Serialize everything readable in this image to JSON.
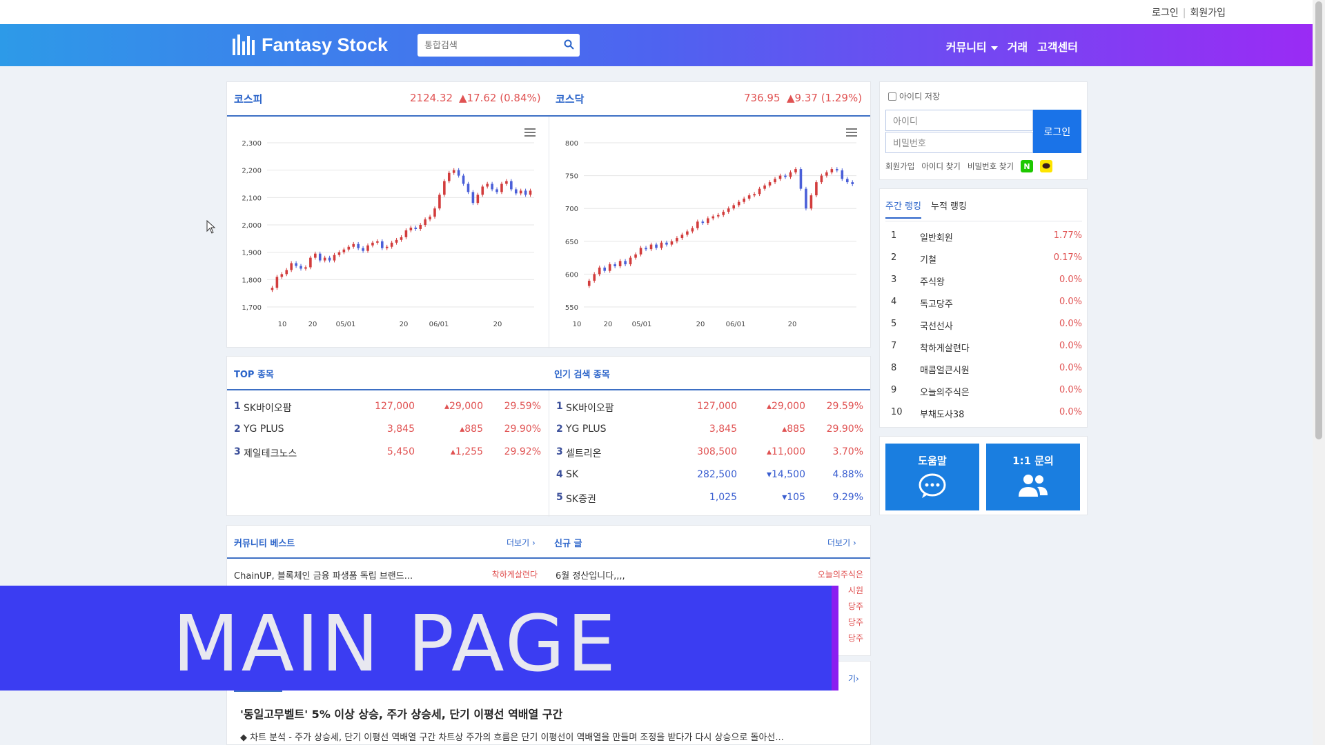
{
  "header": {
    "login": "로그인",
    "signup": "회원가입",
    "logo": "Fantasy Stock",
    "search_placeholder": "통합검색",
    "menu": [
      "커뮤니티",
      "거래",
      "고객센터"
    ]
  },
  "indices": {
    "kospi": {
      "name": "코스피",
      "value": "2124.32",
      "change": "▲17.62 (0.84%)"
    },
    "kosdaq": {
      "name": "코스닥",
      "value": "736.95",
      "change": "▲9.37 (1.29%)"
    }
  },
  "chart_data": [
    {
      "type": "candlestick",
      "name": "코스피",
      "y_ticks": [
        "2,300",
        "2,200",
        "2,100",
        "2,000",
        "1,900",
        "1,800",
        "1,700"
      ],
      "x_ticks": [
        "10",
        "20",
        "05/01",
        "20",
        "06/01",
        "20"
      ],
      "ylim": [
        1700,
        2300
      ],
      "closes": [
        1770,
        1810,
        1820,
        1835,
        1860,
        1850,
        1840,
        1845,
        1880,
        1895,
        1870,
        1880,
        1870,
        1890,
        1900,
        1910,
        1920,
        1930,
        1915,
        1905,
        1925,
        1935,
        1940,
        1915,
        1920,
        1935,
        1945,
        1955,
        1980,
        1990,
        1985,
        2000,
        2020,
        2030,
        2060,
        2110,
        2160,
        2190,
        2200,
        2180,
        2150,
        2120,
        2080,
        2110,
        2140,
        2150,
        2130,
        2120,
        2150,
        2160,
        2130,
        2115,
        2125,
        2110,
        2125
      ]
    },
    {
      "type": "candlestick",
      "name": "코스닥",
      "y_ticks": [
        "800",
        "750",
        "700",
        "650",
        "600",
        "550"
      ],
      "x_ticks": [
        "10",
        "20",
        "05/01",
        "20",
        "06/01",
        "20"
      ],
      "ylim": [
        550,
        800
      ],
      "closes": [
        590,
        600,
        610,
        605,
        615,
        612,
        620,
        615,
        625,
        630,
        640,
        638,
        645,
        640,
        648,
        645,
        650,
        655,
        660,
        665,
        670,
        680,
        678,
        685,
        688,
        690,
        695,
        700,
        705,
        710,
        715,
        720,
        722,
        730,
        735,
        740,
        745,
        750,
        748,
        755,
        760,
        730,
        700,
        720,
        740,
        750,
        755,
        760,
        758,
        745,
        740,
        737
      ]
    }
  ],
  "top_stocks": {
    "title": "TOP 종목",
    "rows": [
      {
        "rank": "1",
        "name": "SK바이오팜",
        "price": "127,000",
        "change": "▴29,000",
        "pct": "29.59%",
        "dir": "up"
      },
      {
        "rank": "2",
        "name": "YG PLUS",
        "price": "3,845",
        "change": "▴885",
        "pct": "29.90%",
        "dir": "up"
      },
      {
        "rank": "3",
        "name": "제일테크노스",
        "price": "5,450",
        "change": "▴1,255",
        "pct": "29.92%",
        "dir": "up"
      }
    ]
  },
  "popular_stocks": {
    "title": "인기 검색 종목",
    "rows": [
      {
        "rank": "1",
        "name": "SK바이오팜",
        "price": "127,000",
        "change": "▴29,000",
        "pct": "29.59%",
        "dir": "up"
      },
      {
        "rank": "2",
        "name": "YG PLUS",
        "price": "3,845",
        "change": "▴885",
        "pct": "29.90%",
        "dir": "up"
      },
      {
        "rank": "3",
        "name": "셀트리온",
        "price": "308,500",
        "change": "▴11,000",
        "pct": "3.70%",
        "dir": "up"
      },
      {
        "rank": "4",
        "name": "SK",
        "price": "282,500",
        "change": "▾14,500",
        "pct": "4.88%",
        "dir": "down"
      },
      {
        "rank": "5",
        "name": "SK증권",
        "price": "1,025",
        "change": "▾105",
        "pct": "9.29%",
        "dir": "down"
      }
    ]
  },
  "community_best": {
    "title": "커뮤니티 베스트",
    "more": "더보기",
    "items": [
      {
        "text": "ChainUP, 블록체인 금융 파생품 독립 브랜드...",
        "author": "착하게살련다"
      }
    ]
  },
  "new_posts": {
    "title": "신규 글",
    "more": "더보기",
    "items": [
      {
        "text": "6월 정산입니다,,,,",
        "author": "오늘의주식은"
      },
      {
        "text": "",
        "author": "시원"
      },
      {
        "text": "",
        "author": "당주"
      },
      {
        "text": "",
        "author": "당주"
      },
      {
        "text": "",
        "author": "당주"
      }
    ]
  },
  "login": {
    "save_id": "아이디 저장",
    "id_placeholder": "아이디",
    "pw_placeholder": "비밀번호",
    "button": "로그인",
    "links": [
      "회원가입",
      "아이디 찾기",
      "비밀번호 찾기"
    ],
    "naver": "N"
  },
  "ranking": {
    "tabs": [
      "주간 랭킹",
      "누적 랭킹"
    ],
    "rows": [
      {
        "rank": "1",
        "user": "일반회원",
        "value": "1.77%"
      },
      {
        "rank": "2",
        "user": "기철",
        "value": "0.17%"
      },
      {
        "rank": "3",
        "user": "주식왕",
        "value": "0.0%"
      },
      {
        "rank": "4",
        "user": "독고당주",
        "value": "0.0%"
      },
      {
        "rank": "5",
        "user": "국선선사",
        "value": "0.0%"
      },
      {
        "rank": "7",
        "user": "착하게살련다",
        "value": "0.0%"
      },
      {
        "rank": "8",
        "user": "매콤얼큰시원",
        "value": "0.0%"
      },
      {
        "rank": "9",
        "user": "오늘의주식은",
        "value": "0.0%"
      },
      {
        "rank": "10",
        "user": "부채도사38",
        "value": "0.0%"
      }
    ]
  },
  "help": {
    "faq": "도움말",
    "inquiry": "1:1 문의"
  },
  "news": {
    "more": "기",
    "title": "'동일고무벨트' 5% 이상 상승, 주가 상승세, 단기 이평선 역배열 구간",
    "desc": "◆ 차트 분석 - 주가 상승세, 단기 이평선 역배열 구간 차트상 주가의 흐름은 단기 이평선이 역배열을 만들며 조정을 받다가 다시 상승으로 돌아선..."
  },
  "banner": {
    "text": "MAIN PAGE"
  },
  "colors": {
    "up": "#e05252",
    "down": "#3a5ed0",
    "accent": "#2a63c9"
  }
}
